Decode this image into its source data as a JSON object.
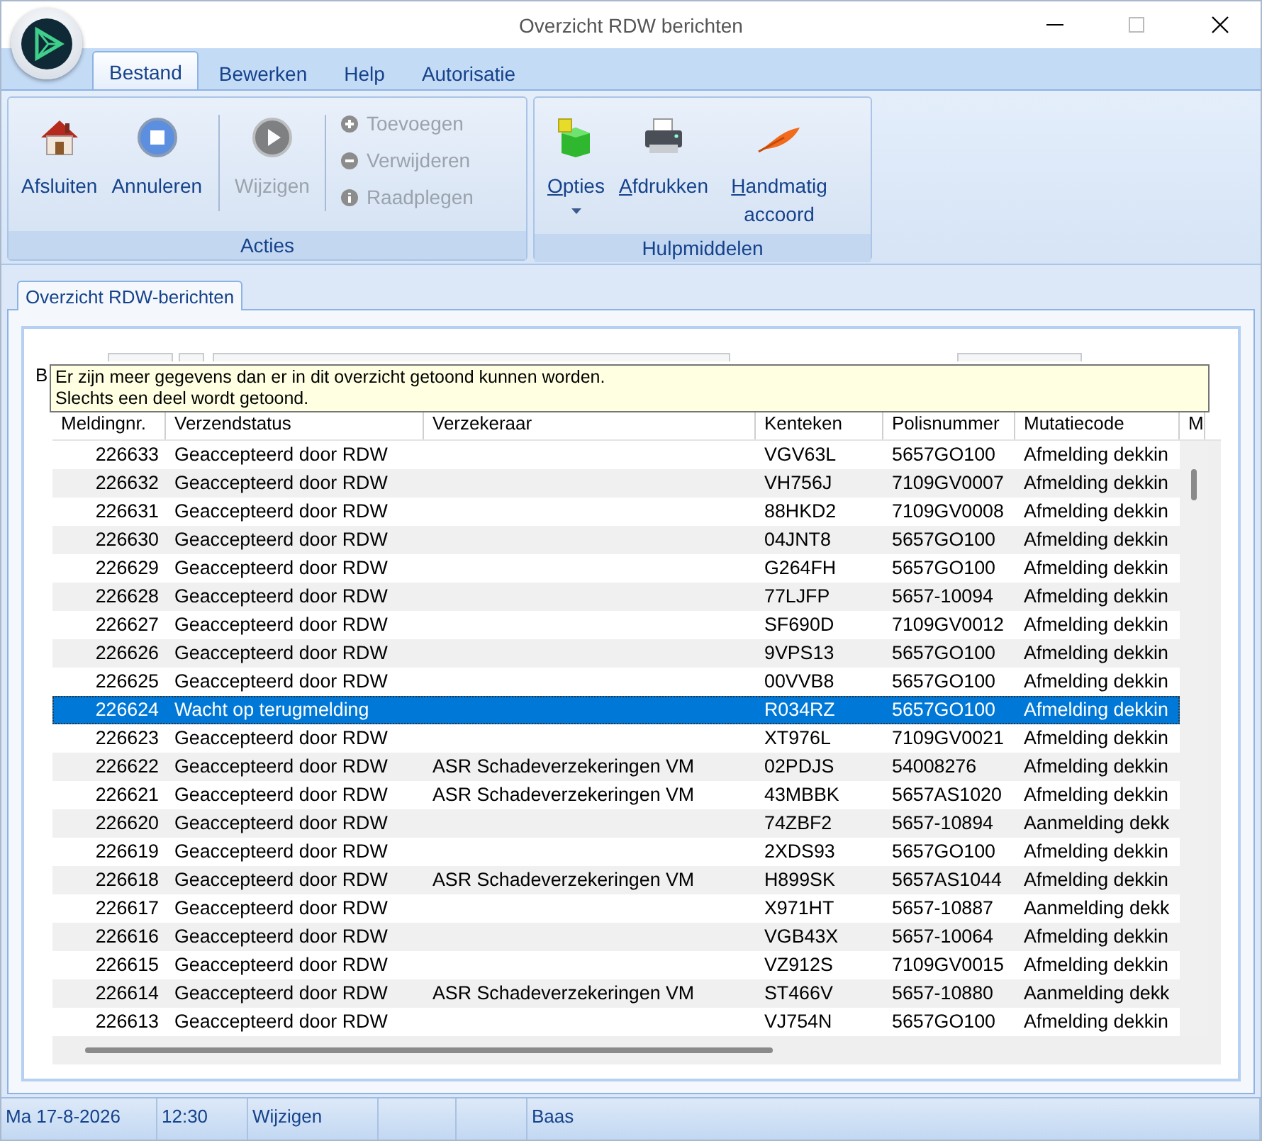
{
  "window": {
    "title": "Overzicht RDW berichten",
    "maximize_disabled": true
  },
  "ribbon": {
    "tabs": [
      {
        "label": "Bestand",
        "selected": true
      },
      {
        "label": "Bewerken",
        "selected": false
      },
      {
        "label": "Help",
        "selected": false
      },
      {
        "label": "Autorisatie",
        "selected": false
      }
    ],
    "groups": [
      {
        "title": "Acties",
        "sections": [
          [
            {
              "kind": "large",
              "label_rest": "Afsluiten",
              "disabled": false
            },
            {
              "kind": "large",
              "label_rest": "Annuleren",
              "disabled": false
            }
          ],
          [
            {
              "kind": "large",
              "label_rest": "Wijzigen",
              "disabled": true
            }
          ],
          [
            {
              "kind": "small",
              "label_rest": "Toevoegen",
              "disabled": true
            },
            {
              "kind": "small",
              "label_rest": "Verwijderen",
              "disabled": true
            },
            {
              "kind": "small",
              "label_rest": "Raadplegen",
              "disabled": true
            }
          ]
        ]
      },
      {
        "title": "Hulpmiddelen",
        "sections": [
          [
            {
              "kind": "dropdown",
              "label_key": "O",
              "label_rest": "pties",
              "disabled": false
            },
            {
              "kind": "large",
              "label_key": "A",
              "label_rest": "fdrukken",
              "disabled": false
            },
            {
              "kind": "large",
              "label_key": "H",
              "label_rest": "andmatig accoord",
              "disabled": false
            }
          ]
        ]
      }
    ]
  },
  "document_tabs": [
    {
      "label": "Overzicht RDW-berichten",
      "selected": true
    }
  ],
  "filter": {
    "label_fragment": "B"
  },
  "tooltip": {
    "lines": [
      "Er zijn meer gegevens dan er in dit overzicht getoond kunnen worden.",
      "Slechts een deel wordt getoond."
    ]
  },
  "table": {
    "columns": [
      "Meldingnr.",
      "Verzendstatus",
      "Verzekeraar",
      "Kenteken",
      "Polisnummer",
      "Mutatiecode",
      "M"
    ],
    "rows": [
      {
        "cells": [
          "226633",
          "Geaccepteerd door RDW",
          "",
          "VGV63L",
          "5657GO100",
          "Afmelding dekkin"
        ],
        "selected": false
      },
      {
        "cells": [
          "226632",
          "Geaccepteerd door RDW",
          "",
          "VH756J",
          "7109GV0007",
          "Afmelding dekkin"
        ],
        "selected": false
      },
      {
        "cells": [
          "226631",
          "Geaccepteerd door RDW",
          "",
          "88HKD2",
          "7109GV0008",
          "Afmelding dekkin"
        ],
        "selected": false
      },
      {
        "cells": [
          "226630",
          "Geaccepteerd door RDW",
          "",
          "04JNT8",
          "5657GO100",
          "Afmelding dekkin"
        ],
        "selected": false
      },
      {
        "cells": [
          "226629",
          "Geaccepteerd door RDW",
          "",
          "G264FH",
          "5657GO100",
          "Afmelding dekkin"
        ],
        "selected": false
      },
      {
        "cells": [
          "226628",
          "Geaccepteerd door RDW",
          "",
          "77LJFP",
          "5657-10094",
          "Afmelding dekkin"
        ],
        "selected": false
      },
      {
        "cells": [
          "226627",
          "Geaccepteerd door RDW",
          "",
          "SF690D",
          "7109GV0012",
          "Afmelding dekkin"
        ],
        "selected": false
      },
      {
        "cells": [
          "226626",
          "Geaccepteerd door RDW",
          "",
          "9VPS13",
          "5657GO100",
          "Afmelding dekkin"
        ],
        "selected": false
      },
      {
        "cells": [
          "226625",
          "Geaccepteerd door RDW",
          "",
          "00VVB8",
          "5657GO100",
          "Afmelding dekkin"
        ],
        "selected": false
      },
      {
        "cells": [
          "226624",
          "Wacht op terugmelding",
          "",
          "R034RZ",
          "5657GO100",
          "Afmelding dekkin"
        ],
        "selected": true
      },
      {
        "cells": [
          "226623",
          "Geaccepteerd door RDW",
          "",
          "XT976L",
          "7109GV0021",
          "Afmelding dekkin"
        ],
        "selected": false
      },
      {
        "cells": [
          "226622",
          "Geaccepteerd door RDW",
          "ASR Schadeverzekeringen VM",
          "02PDJS",
          "54008276",
          "Afmelding dekkin"
        ],
        "selected": false
      },
      {
        "cells": [
          "226621",
          "Geaccepteerd door RDW",
          "ASR Schadeverzekeringen VM",
          "43MBBK",
          "5657AS1020",
          "Afmelding dekkin"
        ],
        "selected": false
      },
      {
        "cells": [
          "226620",
          "Geaccepteerd door RDW",
          "",
          "74ZBF2",
          "5657-10894",
          "Aanmelding dekk"
        ],
        "selected": false
      },
      {
        "cells": [
          "226619",
          "Geaccepteerd door RDW",
          "",
          "2XDS93",
          "5657GO100",
          "Afmelding dekkin"
        ],
        "selected": false
      },
      {
        "cells": [
          "226618",
          "Geaccepteerd door RDW",
          "ASR Schadeverzekeringen VM",
          "H899SK",
          "5657AS1044",
          "Afmelding dekkin"
        ],
        "selected": false
      },
      {
        "cells": [
          "226617",
          "Geaccepteerd door RDW",
          "",
          "X971HT",
          "5657-10887",
          "Aanmelding dekk"
        ],
        "selected": false
      },
      {
        "cells": [
          "226616",
          "Geaccepteerd door RDW",
          "",
          "VGB43X",
          "5657-10064",
          "Afmelding dekkin"
        ],
        "selected": false
      },
      {
        "cells": [
          "226615",
          "Geaccepteerd door RDW",
          "",
          "VZ912S",
          "7109GV0015",
          "Afmelding dekkin"
        ],
        "selected": false
      },
      {
        "cells": [
          "226614",
          "Geaccepteerd door RDW",
          "ASR Schadeverzekeringen VM",
          "ST466V",
          "5657-10880",
          "Aanmelding dekk"
        ],
        "selected": false
      },
      {
        "cells": [
          "226613",
          "Geaccepteerd door RDW",
          "",
          "VJ754N",
          "5657GO100",
          "Afmelding dekkin"
        ],
        "selected": false
      }
    ]
  },
  "status_bar": [
    {
      "kind": "text",
      "text": "Ma 17-8-2026"
    },
    {
      "kind": "text",
      "text": "12:30"
    },
    {
      "kind": "text",
      "text": "Wijzigen"
    },
    {
      "kind": "empty"
    },
    {
      "kind": "empty"
    },
    {
      "kind": "text",
      "text": "Baas"
    }
  ]
}
